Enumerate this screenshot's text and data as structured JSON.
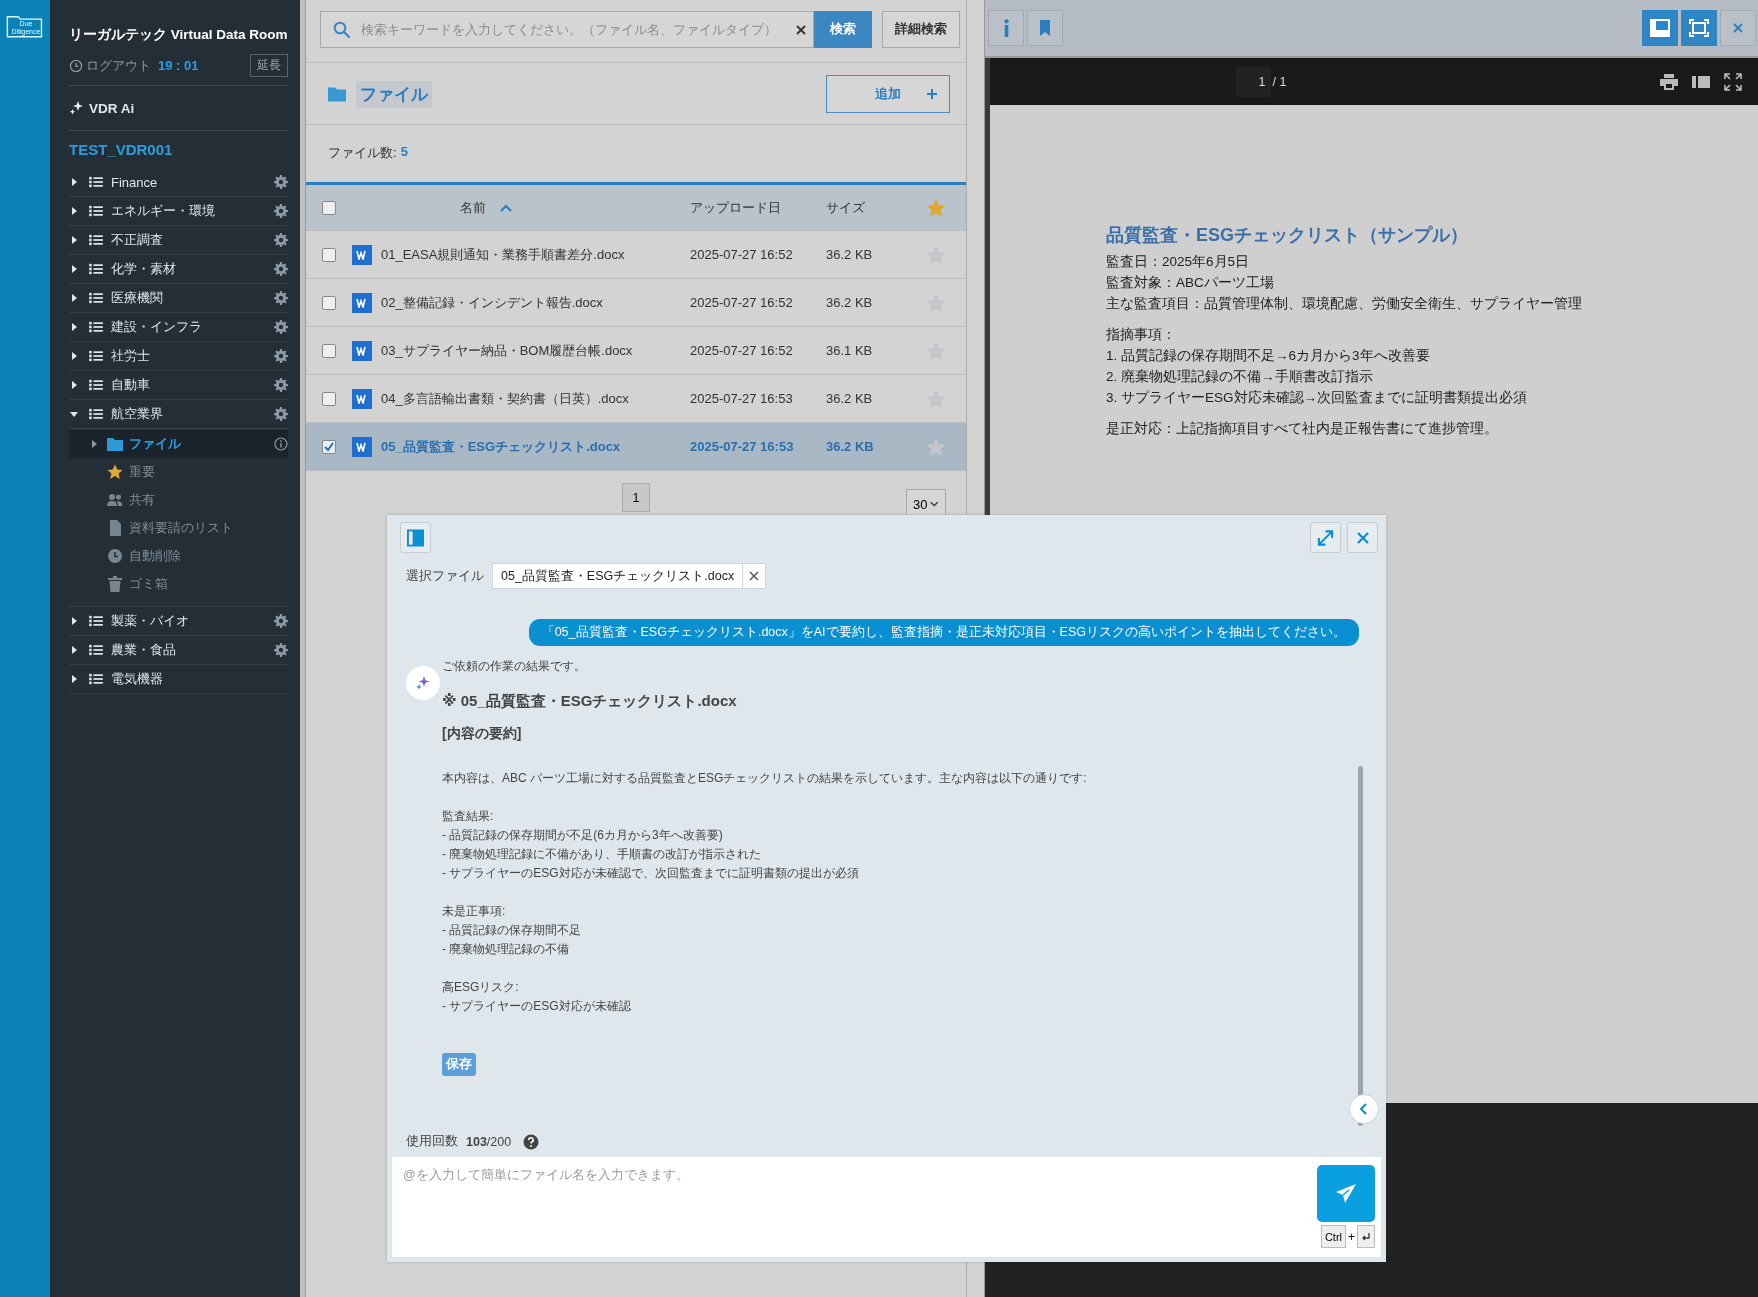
{
  "rail": {
    "logo_text": "Due Diligence"
  },
  "sidebar": {
    "title": "リーガルテック Virtual Data Room",
    "logout_label": "ログアウト",
    "timer": "19 : 01",
    "extend_button": "延長",
    "ai_link": "VDR Ai",
    "room": "TEST_VDR001",
    "tree": [
      {
        "label": "Finance",
        "expanded": false,
        "settings": true
      },
      {
        "label": "エネルギー・環境",
        "expanded": false,
        "settings": true
      },
      {
        "label": "不正調査",
        "expanded": false,
        "settings": true
      },
      {
        "label": "化学・素材",
        "expanded": false,
        "settings": true
      },
      {
        "label": "医療機関",
        "expanded": false,
        "settings": true
      },
      {
        "label": "建設・インフラ",
        "expanded": false,
        "settings": true
      },
      {
        "label": "社労士",
        "expanded": false,
        "settings": true
      },
      {
        "label": "自動車",
        "expanded": false,
        "settings": true
      },
      {
        "label": "航空業界",
        "expanded": true,
        "settings": true,
        "children": [
          {
            "label": "ファイル",
            "kind": "folder",
            "selected": true
          },
          {
            "label": "重要",
            "kind": "star",
            "selected": false
          },
          {
            "label": "共有",
            "kind": "people",
            "selected": false
          },
          {
            "label": "資料要請のリスト",
            "kind": "document",
            "selected": false
          },
          {
            "label": "自動削除",
            "kind": "clock",
            "selected": false
          },
          {
            "label": "ゴミ箱",
            "kind": "trash",
            "selected": false
          }
        ]
      },
      {
        "label": "製薬・バイオ",
        "expanded": false,
        "settings": true
      },
      {
        "label": "農業・食品",
        "expanded": false,
        "settings": true
      },
      {
        "label": "電気機器",
        "expanded": false,
        "settings": false
      }
    ]
  },
  "search": {
    "placeholder": "検索キーワードを入力してください。（ファイル名、ファイルタイプ）",
    "search_button": "検索",
    "advanced_button": "詳細検索"
  },
  "folder": {
    "title": "ファイル",
    "add_button": "追加",
    "file_count_label": "ファイル数:",
    "file_count": "5"
  },
  "table": {
    "all_selected": false,
    "columns": [
      "名前",
      "アップロード日",
      "サイズ"
    ],
    "rows": [
      {
        "name": "01_EASA規則通知・業務手順書差分.docx",
        "date": "2025-07-27 16:52",
        "size": "36.2 KB",
        "selected": false,
        "starred": false
      },
      {
        "name": "02_整備記録・インシデント報告.docx",
        "date": "2025-07-27 16:52",
        "size": "36.2 KB",
        "selected": false,
        "starred": false
      },
      {
        "name": "03_サプライヤー納品・BOM履歴台帳.docx",
        "date": "2025-07-27 16:52",
        "size": "36.1 KB",
        "selected": false,
        "starred": false
      },
      {
        "name": "04_多言語輸出書類・契約書（日英）.docx",
        "date": "2025-07-27 16:53",
        "size": "36.2 KB",
        "selected": false,
        "starred": false
      },
      {
        "name": "05_品質監査・ESGチェックリスト.docx",
        "date": "2025-07-27 16:53",
        "size": "36.2 KB",
        "selected": true,
        "starred": false
      }
    ]
  },
  "pagination": {
    "page": "1",
    "per_page": "30"
  },
  "viewer": {
    "page": "1",
    "page_total": "/ 1",
    "document": {
      "title": "品質監査・ESGチェックリスト（サンプル）",
      "blocks": [
        [
          "監査日：2025年6月5日",
          "監査対象：ABCパーツ工場",
          "主な監査項目：品質管理体制、環境配慮、労働安全衛生、サプライヤー管理"
        ],
        [
          "指摘事項：",
          "1. 品質記録の保存期間不足→6カ月から3年へ改善要",
          "2. 廃棄物処理記録の不備→手順書改訂指示",
          "3. サプライヤーESG対応未確認→次回監査までに証明書類提出必須"
        ],
        [
          "是正対応：上記指摘項目すべて社内是正報告書にて進捗管理。"
        ]
      ]
    }
  },
  "chat": {
    "selected_file_label": "選択ファイル",
    "selected_file": "05_品質監査・ESGチェックリスト.docx",
    "user_message": "「05_品質監査・ESGチェックリスト.docx」をAIで要約し、監査指摘・是正未対応項目・ESGリスクの高いポイントを抽出してください。",
    "reply_intro": "ご依頼の作業の結果です。",
    "reply_heading": "※ 05_品質監査・ESGチェックリスト.docx",
    "reply_section": "[内容の要約]",
    "reply_blocks": [
      [
        "本内容は、ABC パーツ工場に対する品質監査とESGチェックリストの結果を示しています。主な内容は以下の通りです:"
      ],
      [
        "監査結果:",
        "- 品質記録の保存期間が不足(6カ月から3年へ改善要)",
        "- 廃棄物処理記録に不備があり、手順書の改訂が指示された",
        "- サプライヤーのESG対応が未確認で、次回監査までに証明書類の提出が必須"
      ],
      [
        "未是正事項:",
        "- 品質記録の保存期間不足",
        "- 廃棄物処理記録の不備"
      ],
      [
        "高ESGリスク:",
        "- サプライヤーのESG対応が未確認"
      ]
    ],
    "save_button": "保存",
    "usage_label": "使用回数",
    "usage": "**103**/200",
    "input_placeholder": "@を入力して簡単にファイル名を入力できます。",
    "shortcut_key": "Ctrl",
    "shortcut_plus": "+"
  }
}
